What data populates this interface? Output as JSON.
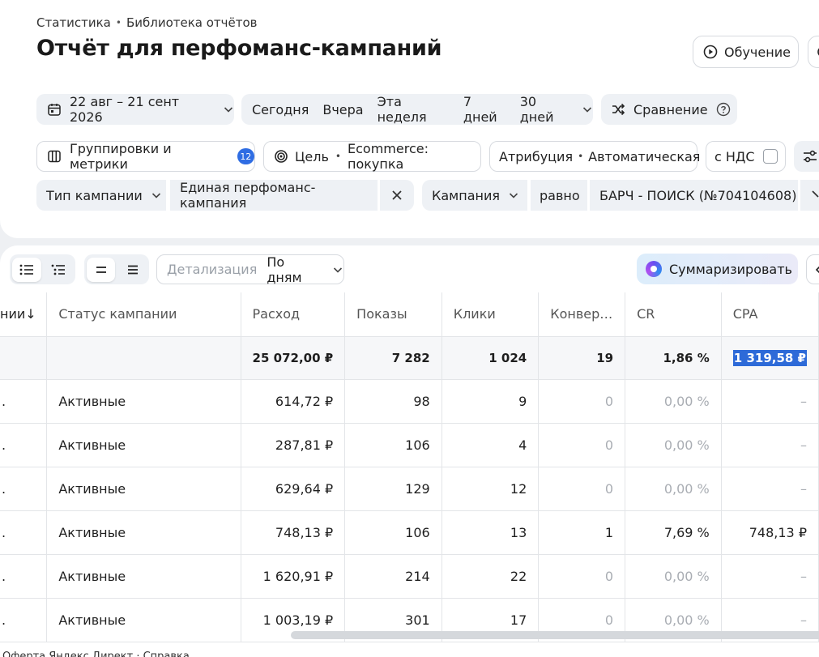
{
  "breadcrumb": {
    "item1": "Статистика",
    "sep": "•",
    "item2": "Библиотека отчётов"
  },
  "title": "Отчёт для перфоманс-кампаний",
  "header": {
    "learn_label": "Обучение"
  },
  "date_range": {
    "label": "22 авг – 21 сент 2026"
  },
  "quick_ranges": [
    "Сегодня",
    "Вчера",
    "Эта неделя",
    "7 дней",
    "30 дней"
  ],
  "compare": {
    "label": "Сравнение"
  },
  "groupings": {
    "label": "Группировки и метрики",
    "count": "12"
  },
  "goal": {
    "label": "Цель",
    "value": "Ecommerce: покупка"
  },
  "attribution": {
    "label": "Атрибуция",
    "value": "Автоматическая"
  },
  "vat": {
    "label": "с НДС"
  },
  "filters": [
    {
      "field": "Тип кампании",
      "value": "Единая перфоманс-кампания"
    },
    {
      "field": "Кампания",
      "operator": "равно",
      "value": "БАРЧ - ПОИСК (№704104608)"
    }
  ],
  "toolbar": {
    "detail_placeholder": "Детализация",
    "detail_value": "По дням",
    "summarize_label": "Суммаризировать"
  },
  "table": {
    "columns": [
      "нии↓",
      "Статус кампании",
      "Расход",
      "Показы",
      "Клики",
      "Конвер…",
      "CR",
      "CPA"
    ],
    "total": [
      "",
      "",
      "25 072,00 ₽",
      "7 282",
      "1 024",
      "19",
      "1,86 %",
      "1 319,58 ₽"
    ],
    "rows": [
      [
        ".",
        "Активные",
        "614,72 ₽",
        "98",
        "9",
        "0",
        "0,00 %",
        "–"
      ],
      [
        ".",
        "Активные",
        "287,81 ₽",
        "106",
        "4",
        "0",
        "0,00 %",
        "–"
      ],
      [
        ".",
        "Активные",
        "629,64 ₽",
        "129",
        "12",
        "0",
        "0,00 %",
        "–"
      ],
      [
        ".",
        "Активные",
        "748,13 ₽",
        "106",
        "13",
        "1",
        "7,69 %",
        "748,13 ₽"
      ],
      [
        ".",
        "Активные",
        "1 620,91 ₽",
        "214",
        "22",
        "0",
        "0,00 %",
        "–"
      ],
      [
        ".",
        "Активные",
        "1 003,19 ₽",
        "301",
        "17",
        "0",
        "0,00 %",
        "–"
      ]
    ]
  },
  "footer": {
    "text": "Оферта Яндекс Директ · Справка"
  },
  "colors": {
    "accent": "#2f6de3",
    "selection": "#2d6ad8",
    "muted": "#a9adb3"
  }
}
